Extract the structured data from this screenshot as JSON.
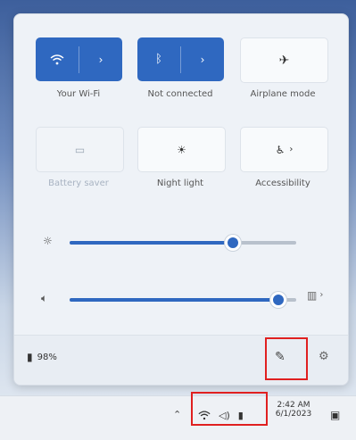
{
  "quick_settings": {
    "wifi_label": "Your Wi-Fi",
    "bluetooth_label": "Not connected",
    "airplane_label": "Airplane mode",
    "battery_saver_label": "Battery saver",
    "night_light_label": "Night light",
    "accessibility_label": "Accessibility",
    "battery_percent": "98%",
    "brightness_level": 0.72,
    "volume_level": 0.92
  },
  "taskbar": {
    "time": "2:42 AM",
    "date": "6/1/2023"
  },
  "icons": {
    "wifi": "wifi-icon",
    "bluetooth": "bluetooth-icon",
    "airplane": "airplane-icon",
    "battery_saver": "battery-saver-icon",
    "night_light": "night-light-icon",
    "accessibility": "accessibility-icon",
    "brightness": "brightness-icon",
    "volume": "volume-icon",
    "audio_output": "audio-output-icon",
    "battery": "battery-icon",
    "edit": "pencil-icon",
    "settings": "gear-icon",
    "chevron_up": "chevron-up-icon",
    "notification": "notification-icon"
  },
  "colors": {
    "accent": "#2f68c0",
    "highlight_box": "#e02020"
  }
}
